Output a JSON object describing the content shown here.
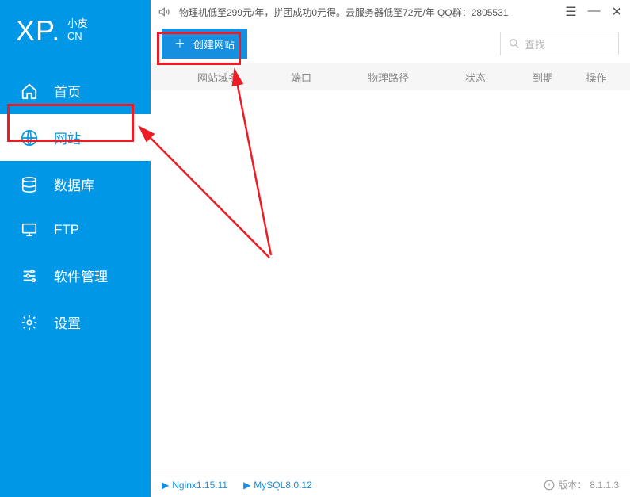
{
  "logo": {
    "main": "XP.",
    "sub1": "小皮",
    "sub2": "CN"
  },
  "nav": {
    "home": "首页",
    "website": "网站",
    "database": "数据库",
    "ftp": "FTP",
    "software": "软件管理",
    "settings": "设置"
  },
  "titlebar": {
    "promo": "物理机低至299元/年，拼团成功0元得。云服务器低至72元/年   QQ群：2805531"
  },
  "toolbar": {
    "create_label": "创建网站",
    "search_placeholder": "查找"
  },
  "table": {
    "domain": "网站域名",
    "port": "端口",
    "path": "物理路径",
    "status": "状态",
    "expire": "到期",
    "action": "操作"
  },
  "footer": {
    "srv1": "Nginx1.15.11",
    "srv2": "MySQL8.0.12",
    "version_label": "版本：",
    "version": "8.1.1.3"
  }
}
